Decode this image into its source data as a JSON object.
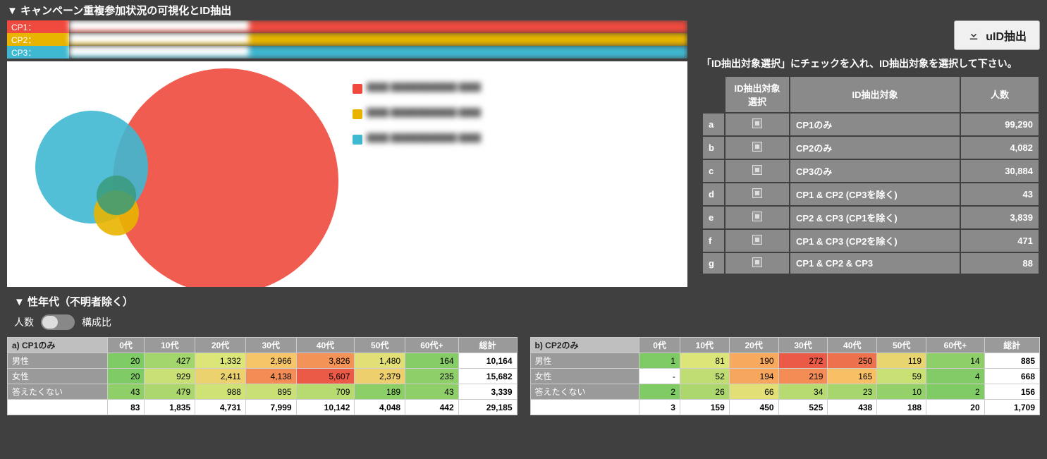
{
  "section1_title": "▼ キャンペーン重複参加状況の可視化とID抽出",
  "campaigns": [
    {
      "key": "CP1：",
      "color": "#f04a3e"
    },
    {
      "key": "CP2：",
      "color": "#e8b400"
    },
    {
      "key": "CP3：",
      "color": "#3fb8d1"
    }
  ],
  "extract_button": "uID抽出",
  "instruction": "「ID抽出対象選択」にチェックを入れ、ID抽出対象を選択して下さい。",
  "id_table": {
    "headers": [
      "ID抽出対象選択",
      "ID抽出対象",
      "人数"
    ],
    "rows": [
      {
        "key": "a",
        "target": "CP1のみ",
        "count": "99,290"
      },
      {
        "key": "b",
        "target": "CP2のみ",
        "count": "4,082"
      },
      {
        "key": "c",
        "target": "CP3のみ",
        "count": "30,884"
      },
      {
        "key": "d",
        "target": "CP1 & CP2 (CP3を除く)",
        "count": "43"
      },
      {
        "key": "e",
        "target": "CP2 & CP3 (CP1を除く)",
        "count": "3,839"
      },
      {
        "key": "f",
        "target": "CP1 & CP3 (CP2を除く)",
        "count": "471"
      },
      {
        "key": "g",
        "target": "CP1 & CP2 & CP3",
        "count": "88"
      }
    ]
  },
  "section2_title": "▼ 性年代（不明者除く）",
  "toggle": {
    "left": "人数",
    "right": "構成比"
  },
  "chart_data": {
    "type": "venn",
    "sets": [
      {
        "label": "CP1",
        "color": "#f04a3e",
        "size": 99892
      },
      {
        "label": "CP2",
        "color": "#e8b400",
        "size": 8052
      },
      {
        "label": "CP3",
        "color": "#3fb8d1",
        "size": 35282
      }
    ],
    "overlaps": [
      {
        "sets": [
          "CP1",
          "CP2"
        ],
        "size": 131
      },
      {
        "sets": [
          "CP2",
          "CP3"
        ],
        "size": 3927
      },
      {
        "sets": [
          "CP1",
          "CP3"
        ],
        "size": 559
      },
      {
        "sets": [
          "CP1",
          "CP2",
          "CP3"
        ],
        "size": 88
      }
    ]
  },
  "heatmaps": [
    {
      "title": "a) CP1のみ",
      "cols": [
        "0代",
        "10代",
        "20代",
        "30代",
        "40代",
        "50代",
        "60代+",
        "総計"
      ],
      "rows": [
        {
          "label": "男性",
          "vals": [
            "20",
            "427",
            "1,332",
            "2,966",
            "3,826",
            "1,480",
            "164",
            "10,164"
          ]
        },
        {
          "label": "女性",
          "vals": [
            "20",
            "929",
            "2,411",
            "4,138",
            "5,607",
            "2,379",
            "235",
            "15,682"
          ]
        },
        {
          "label": "答えたくない",
          "vals": [
            "43",
            "479",
            "988",
            "895",
            "709",
            "189",
            "43",
            "3,339"
          ]
        },
        {
          "label": "総計",
          "vals": [
            "83",
            "1,835",
            "4,731",
            "7,999",
            "10,142",
            "4,048",
            "442",
            "29,185"
          ]
        }
      ],
      "heat": [
        [
          0.02,
          0.15,
          0.35,
          0.6,
          0.8,
          0.4,
          0.05,
          null
        ],
        [
          0.02,
          0.28,
          0.5,
          0.82,
          1.0,
          0.52,
          0.08,
          null
        ],
        [
          0.08,
          0.18,
          0.3,
          0.28,
          0.22,
          0.07,
          0.08,
          null
        ],
        [
          null,
          null,
          null,
          null,
          null,
          null,
          null,
          null
        ]
      ]
    },
    {
      "title": "b) CP2のみ",
      "cols": [
        "0代",
        "10代",
        "20代",
        "30代",
        "40代",
        "50代",
        "60代+",
        "総計"
      ],
      "rows": [
        {
          "label": "男性",
          "vals": [
            "1",
            "81",
            "190",
            "272",
            "250",
            "119",
            "14",
            "885"
          ]
        },
        {
          "label": "女性",
          "vals": [
            "-",
            "52",
            "194",
            "219",
            "165",
            "59",
            "4",
            "668"
          ]
        },
        {
          "label": "答えたくない",
          "vals": [
            "2",
            "26",
            "66",
            "34",
            "23",
            "10",
            "2",
            "156"
          ]
        },
        {
          "label": "総計",
          "vals": [
            "3",
            "159",
            "450",
            "525",
            "438",
            "188",
            "20",
            "1,709"
          ]
        }
      ],
      "heat": [
        [
          0.02,
          0.35,
          0.72,
          1.0,
          0.92,
          0.48,
          0.08,
          null
        ],
        [
          null,
          0.25,
          0.73,
          0.82,
          0.64,
          0.28,
          0.04,
          null
        ],
        [
          0.03,
          0.18,
          0.4,
          0.22,
          0.16,
          0.1,
          0.03,
          null
        ],
        [
          null,
          null,
          null,
          null,
          null,
          null,
          null,
          null
        ]
      ]
    }
  ]
}
